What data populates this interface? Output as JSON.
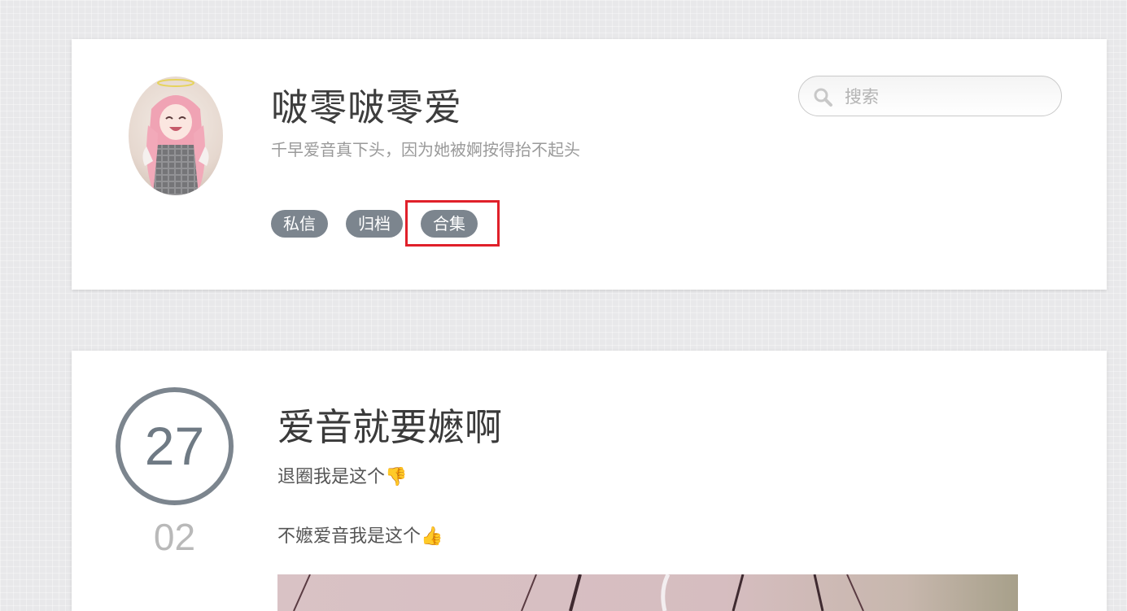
{
  "header": {
    "blog_title": "啵零啵零爱",
    "subtitle": "千早爱音真下头，因为她被婀按得抬不起头",
    "avatar_icon": "anime-avatar-pink-hair-halo",
    "nav": [
      {
        "label": "私信"
      },
      {
        "label": "归档"
      },
      {
        "label": "合集"
      }
    ],
    "search": {
      "placeholder": "搜索",
      "value": ""
    }
  },
  "post": {
    "day": "27",
    "month": "02",
    "title": "爱音就要嬷啊",
    "line1_text": "退圈我是这个",
    "line1_emoji": "👎",
    "line2_text": "不嬷爱音我是这个",
    "line2_emoji": "👍"
  },
  "colors": {
    "pill_bg": "#7c858e",
    "highlight": "#e0202a",
    "background": "#e8e8ea"
  }
}
